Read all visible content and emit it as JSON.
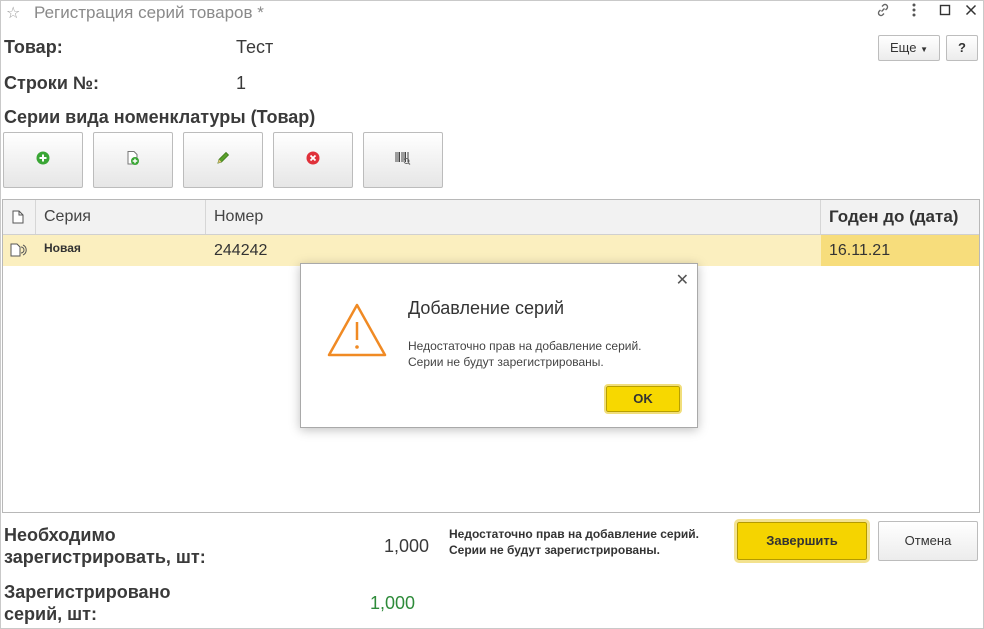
{
  "window": {
    "title": "Регистрация серий товаров *",
    "more_label": "Еще",
    "help_label": "?"
  },
  "form": {
    "product_label": "Товар:",
    "product_value": "Тест",
    "row_label": "Строки №:",
    "row_value": "1",
    "section_title": "Серии вида номенклатуры (Товар)"
  },
  "toolbar": {
    "icons": [
      "add-icon",
      "copy-icon",
      "edit-icon",
      "delete-icon",
      "barcode-icon"
    ],
    "colors": {
      "add": "#3aa635",
      "delete": "#e0313a",
      "edit": "#5aa02c"
    }
  },
  "table": {
    "headers": [
      "Серия",
      "Номер",
      "Годен до (дата)"
    ],
    "rows": [
      {
        "series": "Новая",
        "number": "244242",
        "expiry": "16.11.21"
      }
    ]
  },
  "dialog": {
    "title": "Добавление серий",
    "message_line1": "Недостаточно прав на добавление серий.",
    "message_line2": "Серии не будут зарегистрированы.",
    "ok_label": "OK"
  },
  "summary": {
    "need_label_line1": "Необходимо",
    "need_label_line2": "зарегистрировать, шт:",
    "need_value": "1,000",
    "registered_label_line1": "Зарегистрировано",
    "registered_label_line2": "серий, шт:",
    "registered_value": "1,000",
    "registered_color": "#2e8b3a",
    "warning_line1": "Недостаточно прав на добавление серий.",
    "warning_line2": "Серии не будут зарегистрированы.",
    "finish_label": "Завершить",
    "cancel_label": "Отмена"
  }
}
